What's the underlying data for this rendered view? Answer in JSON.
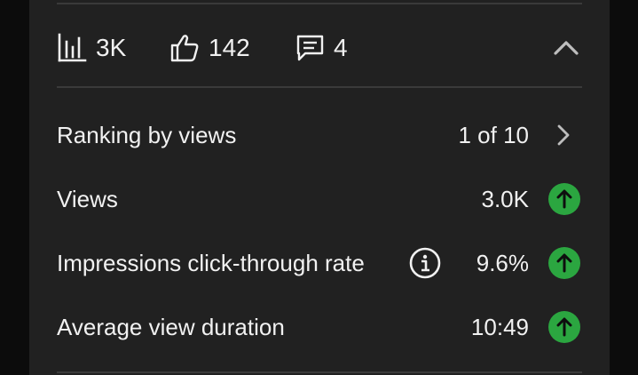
{
  "stats": {
    "views": "3K",
    "likes": "142",
    "comments": "4"
  },
  "metrics": [
    {
      "label": "Ranking by views",
      "value": "1 of 10",
      "trailing": "chevron-right-icon"
    },
    {
      "label": "Views",
      "value": "3.0K",
      "trailing": "trend-up-icon"
    },
    {
      "label": "Impressions click-through rate",
      "value": "9.6%",
      "trailing": "trend-up-icon",
      "info_icon": "info-icon"
    },
    {
      "label": "Average view duration",
      "value": "10:49",
      "trailing": "trend-up-icon"
    }
  ],
  "colors": {
    "card_background": "#212121",
    "page_background": "#0c0c0c",
    "trend_up": "#2ba640",
    "text": "#f1f1f1",
    "divider": "#3a3a3a"
  },
  "icons": [
    "bar-chart-icon",
    "thumbs-up-icon",
    "comment-icon",
    "chevron-up-icon",
    "chevron-right-icon",
    "info-icon",
    "trend-up-icon"
  ]
}
